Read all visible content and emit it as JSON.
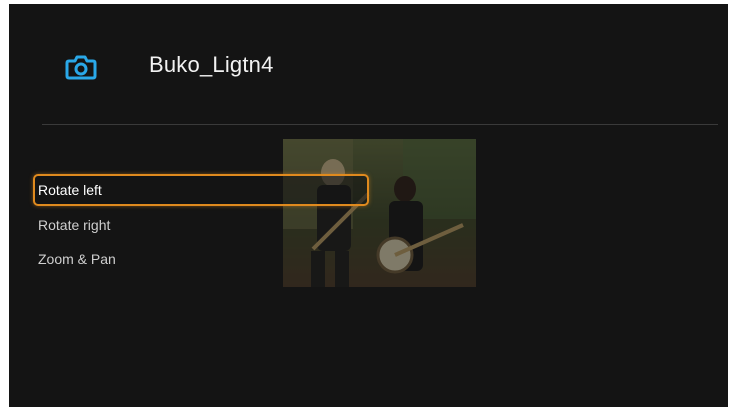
{
  "header": {
    "title": "Buko_Ligtn4",
    "icon": "camera-icon"
  },
  "context_menu": {
    "items": [
      {
        "label": "Rotate left",
        "selected": true
      },
      {
        "label": "Rotate right",
        "selected": false
      },
      {
        "label": "Zoom & Pan",
        "selected": false
      }
    ]
  },
  "colors": {
    "background": "#141414",
    "icon_accent": "#2aa8e8",
    "selection_border": "#e08a1e"
  }
}
